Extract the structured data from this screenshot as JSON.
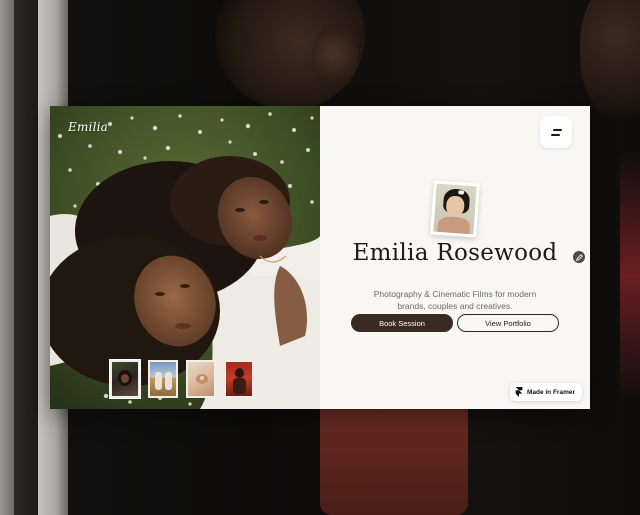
{
  "site": {
    "logo": "Emilia",
    "name": "Emilia Rosewood",
    "tagline": "Photography & Cinematic Films for modern brands, couples and creatives.",
    "primary_cta": "Book Session",
    "secondary_cta": "View Portfolio",
    "badge": "Made in Framer"
  },
  "icons": {
    "menu": "menu-icon",
    "edit": "edit-icon",
    "framer": "framer-logo-icon"
  },
  "colors": {
    "primary_button": "#3a2a22",
    "panel_background": "#f8f7f3",
    "text": "#1d1a17",
    "muted_text": "#6c6a66"
  },
  "gallery": {
    "thumbnail_count": 4,
    "active_thumbnail": 1
  }
}
